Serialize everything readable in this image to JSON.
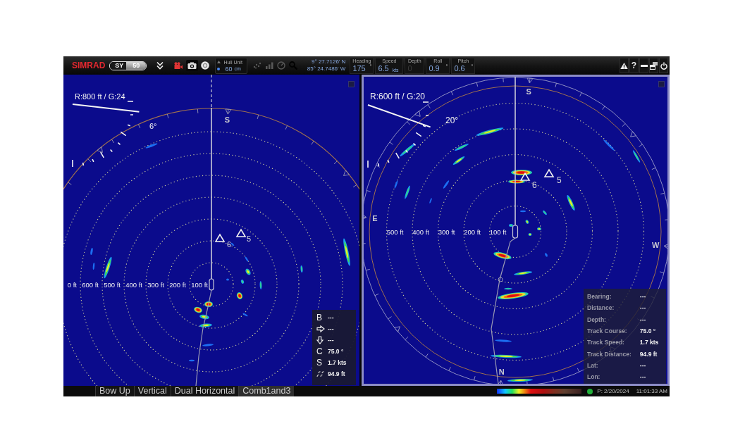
{
  "app_bar": {
    "logo": "SIMRAD",
    "model": [
      "SY",
      "50"
    ],
    "hull_unit": {
      "label": "Hull Unit",
      "value": "60",
      "unit": "cm"
    },
    "view_tools": [
      {
        "disabled": true
      },
      {
        "disabled": true
      },
      {
        "disabled": true
      },
      {
        "disabled": true
      }
    ],
    "position": [
      "9° 27.7126' N",
      "85° 24.7486' W"
    ],
    "gauges": [
      {
        "label": "Heading",
        "value": "175",
        "unit": "°",
        "disabled": false
      },
      {
        "label": "Speed",
        "value": "6.5",
        "unit": "kts",
        "disabled": false
      },
      {
        "label": "Depth",
        "value": "0",
        "disabled": true
      },
      {
        "label": "Roll",
        "value": "0.9",
        "unit": "°",
        "disabled": false
      },
      {
        "label": "Pitch",
        "value": "0.6",
        "unit": "°",
        "disabled": false
      }
    ],
    "window_buttons": [
      {
        "kind": "alert"
      },
      {
        "kind": "help",
        "label": "?"
      },
      {
        "kind": "minimize"
      },
      {
        "kind": "restore"
      },
      {
        "kind": "power"
      }
    ]
  },
  "views": [
    {
      "selected": false,
      "range_gain": "R:800 ft / G:24",
      "tilt": "6°",
      "compass_labels": [
        "S"
      ],
      "range_labels": [
        "0 ft",
        "600 ft",
        "500 ft",
        "400 ft",
        "300 ft",
        "200 ft",
        "100 ft"
      ],
      "targets": [
        "6",
        "5"
      ],
      "readouts": [
        {
          "kind": "letter",
          "label": "B",
          "value": "---"
        },
        {
          "kind": "arrow_right",
          "value": "---"
        },
        {
          "kind": "arrow_down",
          "value": "---"
        },
        {
          "kind": "letter",
          "label": "C",
          "value": "75.0 °"
        },
        {
          "kind": "letter",
          "label": "S",
          "value": "1.7 kts"
        },
        {
          "kind": "track",
          "value": "94.9 ft"
        }
      ]
    },
    {
      "selected": true,
      "range_gain": "R:600 ft / G:20",
      "tilt": "20°",
      "compass_labels": [
        "S",
        "E",
        "W",
        "N"
      ],
      "range_labels": [
        "500 ft",
        "400 ft",
        "300 ft",
        "200 ft",
        "100 ft"
      ],
      "targets": [
        "6",
        "5"
      ],
      "info": [
        {
          "label": "Bearing:",
          "value": "---"
        },
        {
          "label": "Distance:",
          "value": "---"
        },
        {
          "label": "Depth:",
          "value": "---"
        },
        {
          "label": "Track Course:",
          "value": "75.0 °"
        },
        {
          "label": "Track Speed:",
          "value": "1.7 kts"
        },
        {
          "label": "Track Distance:",
          "value": "94.9 ft"
        },
        {
          "label": "Lat:",
          "value": "---"
        },
        {
          "label": "Lon:",
          "value": "---"
        }
      ]
    }
  ],
  "status_bar": {
    "tabs": [
      {
        "label": "Bow Up",
        "selected": false
      },
      {
        "label": "Vertical",
        "selected": false
      },
      {
        "label": "Dual Horizontal",
        "selected": false
      },
      {
        "label": "Comb1and3",
        "selected": true
      }
    ],
    "date": "P: 2/20/2024",
    "time": "11:01:33 AM"
  }
}
